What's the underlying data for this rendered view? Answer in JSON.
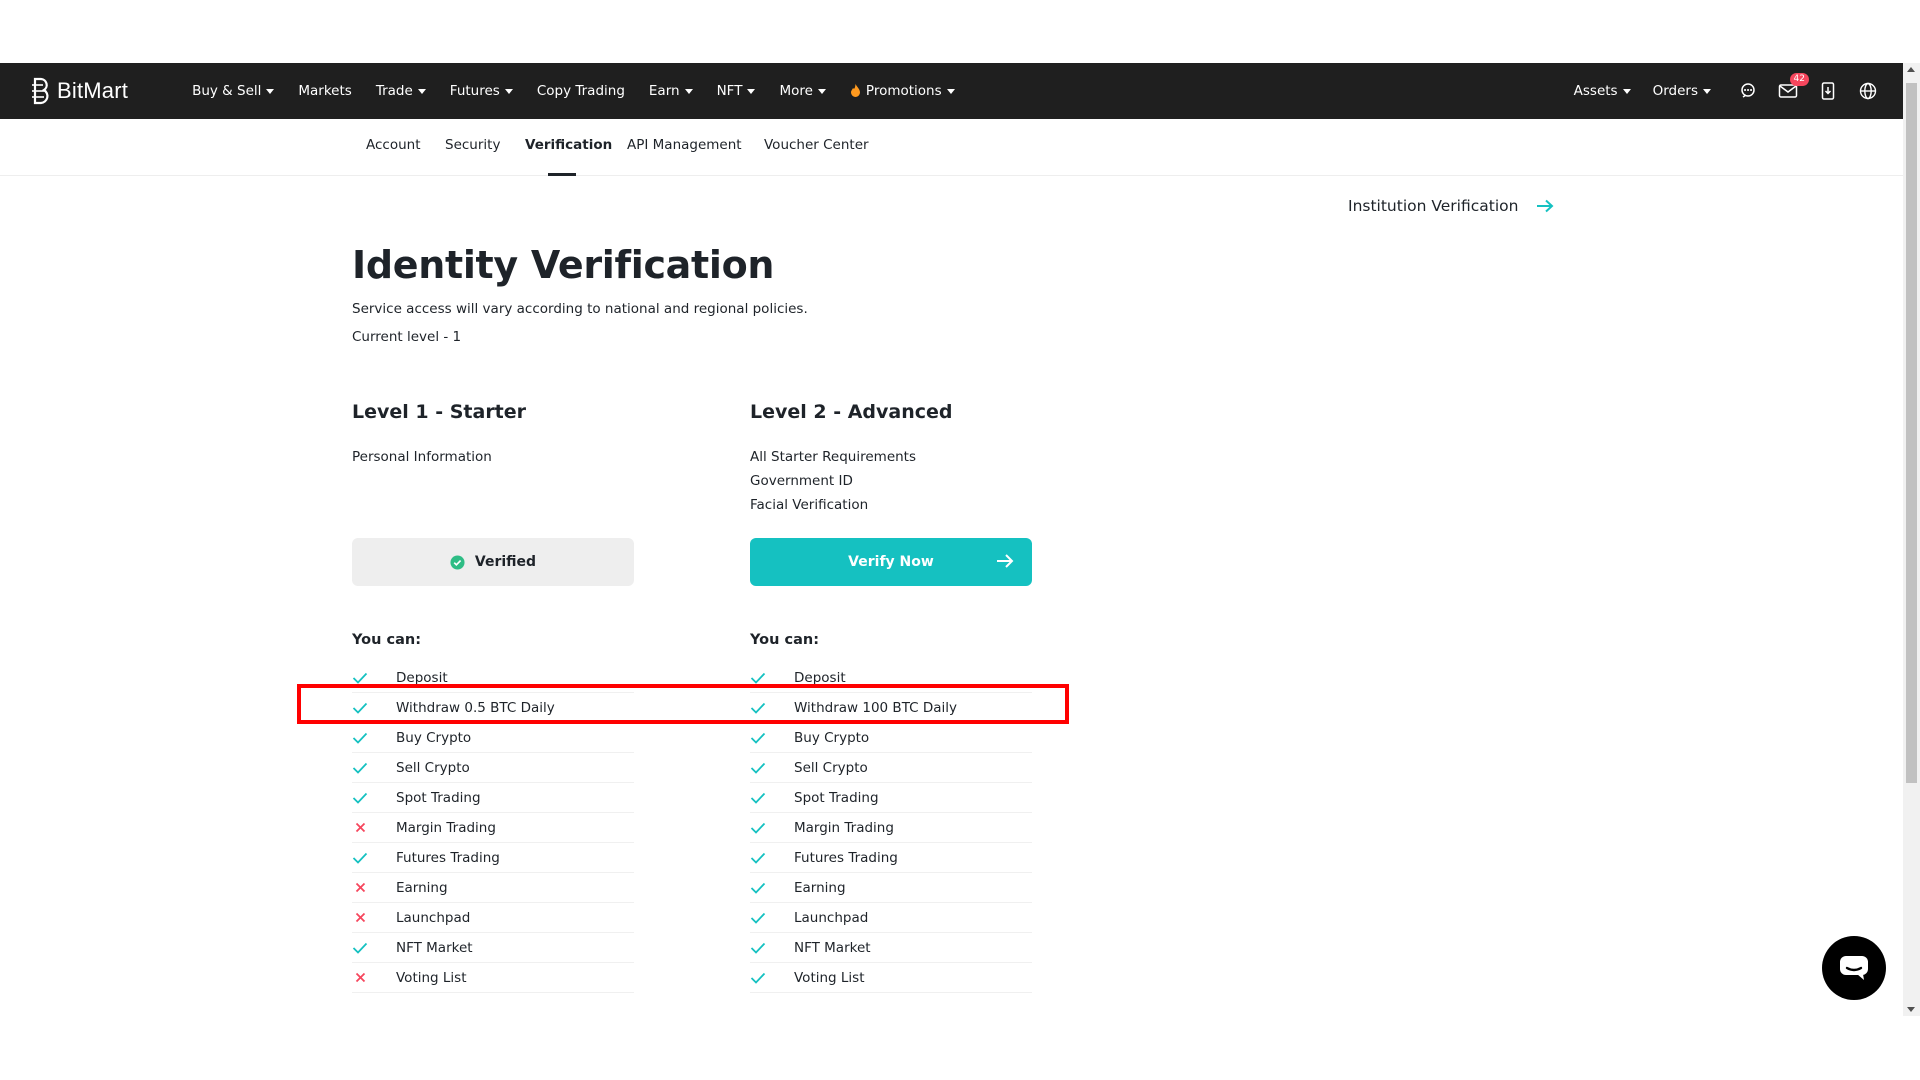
{
  "brand": {
    "name": "BitMart"
  },
  "nav": {
    "items": [
      {
        "label": "Buy & Sell",
        "caret": true
      },
      {
        "label": "Markets",
        "caret": false
      },
      {
        "label": "Trade",
        "caret": true
      },
      {
        "label": "Futures",
        "caret": true
      },
      {
        "label": "Copy Trading",
        "caret": false
      },
      {
        "label": "Earn",
        "caret": true
      },
      {
        "label": "NFT",
        "caret": true
      },
      {
        "label": "More",
        "caret": true
      },
      {
        "label": "Promotions",
        "caret": true
      }
    ],
    "right": {
      "assets_label": "Assets",
      "orders_label": "Orders",
      "messages_badge": "42",
      "icons": [
        "support-icon",
        "mail-icon",
        "download-app-icon",
        "globe-icon"
      ]
    }
  },
  "subnav": {
    "tabs": [
      "Account",
      "Security",
      "Verification",
      "API Management",
      "Voucher Center"
    ],
    "active": "Verification"
  },
  "institution_link": "Institution Verification",
  "page": {
    "title": "Identity Verification",
    "subtitle": "Service access will vary according to national and regional policies.",
    "current_level": "Current level - 1"
  },
  "levels": [
    {
      "title": "Level 1 - Starter",
      "requirements": [
        "Personal Information"
      ],
      "button_label": "Verified",
      "you_can_label": "You can:",
      "features": [
        {
          "label": "Deposit",
          "allowed": true
        },
        {
          "label": "Withdraw 0.5 BTC Daily",
          "allowed": true
        },
        {
          "label": "Buy Crypto",
          "allowed": true
        },
        {
          "label": "Sell Crypto",
          "allowed": true
        },
        {
          "label": "Spot Trading",
          "allowed": true
        },
        {
          "label": "Margin Trading",
          "allowed": false
        },
        {
          "label": "Futures Trading",
          "allowed": true
        },
        {
          "label": "Earning",
          "allowed": false
        },
        {
          "label": "Launchpad",
          "allowed": false
        },
        {
          "label": "NFT Market",
          "allowed": true
        },
        {
          "label": "Voting List",
          "allowed": false
        }
      ]
    },
    {
      "title": "Level 2 - Advanced",
      "requirements": [
        "All Starter Requirements",
        "Government ID",
        "Facial Verification"
      ],
      "button_label": "Verify Now",
      "you_can_label": "You can:",
      "features": [
        {
          "label": "Deposit",
          "allowed": true
        },
        {
          "label": "Withdraw 100 BTC Daily",
          "allowed": true
        },
        {
          "label": "Buy Crypto",
          "allowed": true
        },
        {
          "label": "Sell Crypto",
          "allowed": true
        },
        {
          "label": "Spot Trading",
          "allowed": true
        },
        {
          "label": "Margin Trading",
          "allowed": true
        },
        {
          "label": "Futures Trading",
          "allowed": true
        },
        {
          "label": "Earning",
          "allowed": true
        },
        {
          "label": "Launchpad",
          "allowed": true
        },
        {
          "label": "NFT Market",
          "allowed": true
        },
        {
          "label": "Voting List",
          "allowed": true
        }
      ]
    }
  ],
  "colors": {
    "navbar_bg": "#1f1f1f",
    "accent": "#15c1c1",
    "check": "#15c1c1",
    "cross": "#f6465d",
    "verified_green": "#2ebd85",
    "highlight": "#ff0000"
  }
}
